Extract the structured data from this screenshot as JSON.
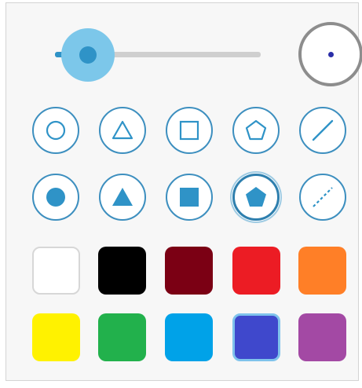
{
  "brush": {
    "size_fraction": 0.16,
    "preview_color": "#2b2ea8"
  },
  "shapes": {
    "outline": [
      {
        "name": "circle-outline",
        "icon": "circle-outline-icon"
      },
      {
        "name": "triangle-outline",
        "icon": "triangle-outline-icon"
      },
      {
        "name": "square-outline",
        "icon": "square-outline-icon"
      },
      {
        "name": "pentagon-outline",
        "icon": "pentagon-outline-icon"
      },
      {
        "name": "line-solid",
        "icon": "line-solid-icon"
      }
    ],
    "filled": [
      {
        "name": "circle-filled",
        "icon": "circle-filled-icon"
      },
      {
        "name": "triangle-filled",
        "icon": "triangle-filled-icon"
      },
      {
        "name": "square-filled",
        "icon": "square-filled-icon"
      },
      {
        "name": "pentagon-filled",
        "icon": "pentagon-filled-icon",
        "selected": true
      },
      {
        "name": "line-dashed",
        "icon": "line-dashed-icon"
      }
    ],
    "icon_color": "#2f93c7"
  },
  "colors": {
    "row1": [
      "#ffffff",
      "#000000",
      "#7b0014",
      "#ec1c24",
      "#ff7f27"
    ],
    "row2": [
      "#fff200",
      "#22b14c",
      "#00a2e8",
      "#3f48cc",
      "#a349a4"
    ],
    "selected": "#3f48cc"
  }
}
